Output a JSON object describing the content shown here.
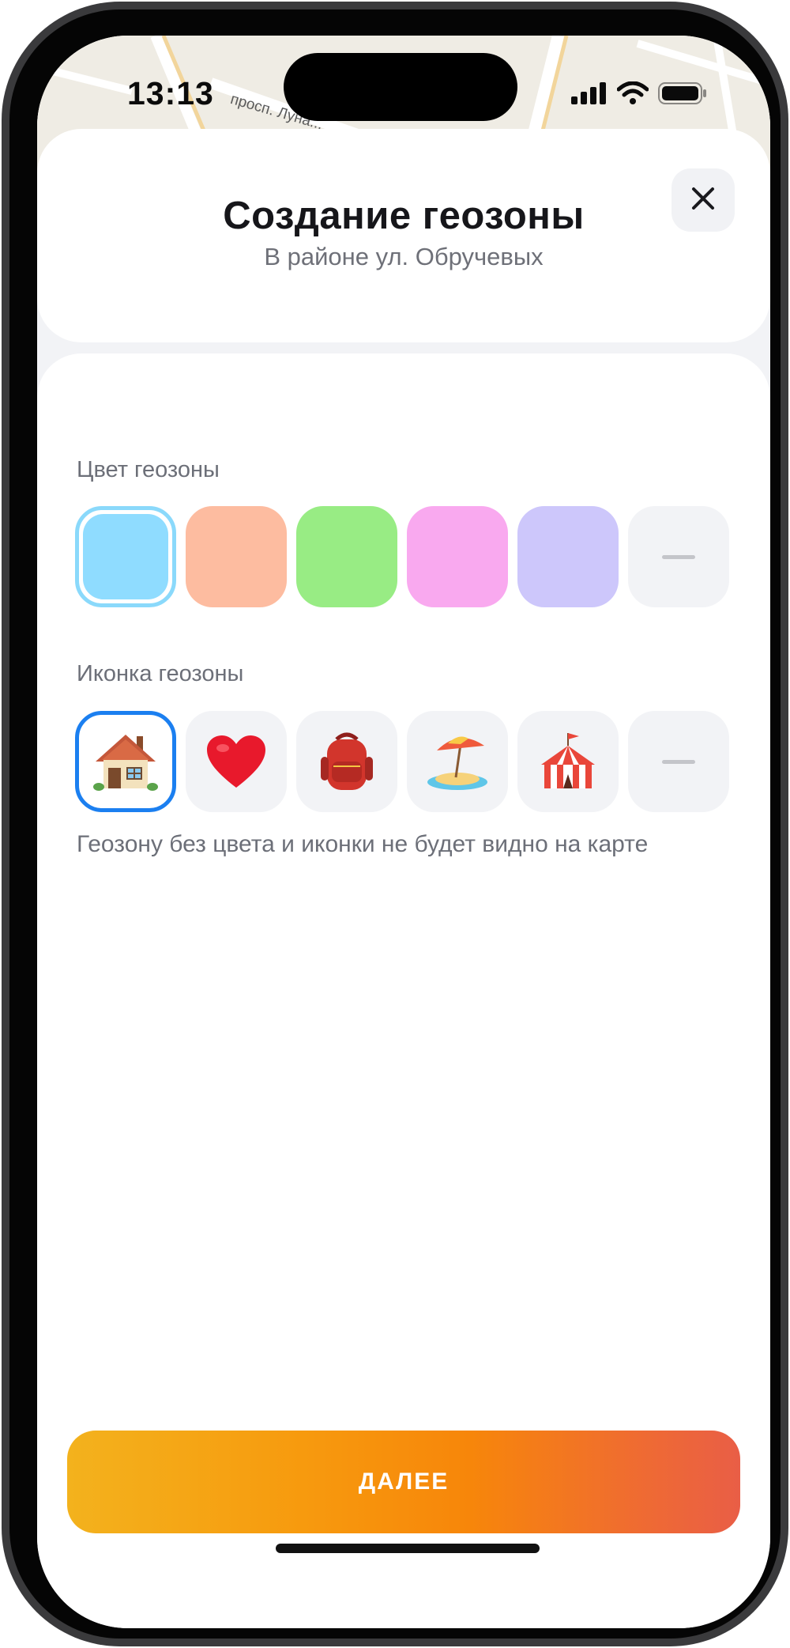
{
  "status_bar": {
    "time": "13:13"
  },
  "map": {
    "road_label": "просп. Луна..."
  },
  "header": {
    "title": "Создание геозоны",
    "subtitle": "В районе ул. Обручевых",
    "close_icon": "close-icon"
  },
  "color_section": {
    "label": "Цвет геозоны",
    "colors": [
      "#8fdcff",
      "#fdbca0",
      "#98ec84",
      "#f9a9ef",
      "#cdc7fb"
    ],
    "selected_index": 0,
    "none_option": "dash-icon"
  },
  "icon_section": {
    "label": "Иконка геозоны",
    "icons": [
      "🏠",
      "❤️",
      "🎒",
      "🏖️",
      "🎪"
    ],
    "icon_names": [
      "house-icon",
      "heart-icon",
      "backpack-icon",
      "beach-icon",
      "circus-tent-icon"
    ],
    "selected_index": 0,
    "none_option": "dash-icon"
  },
  "hint": "Геозону без цвета и иконки не будет видно на карте",
  "footer": {
    "next_label": "ДАЛЕЕ"
  },
  "accent_colors": {
    "selected_icon_border": "#1b7ff0",
    "selected_color_border": "#8ad9fb",
    "button_gradient_start": "#f3b21d",
    "button_gradient_end": "#e95e46"
  }
}
